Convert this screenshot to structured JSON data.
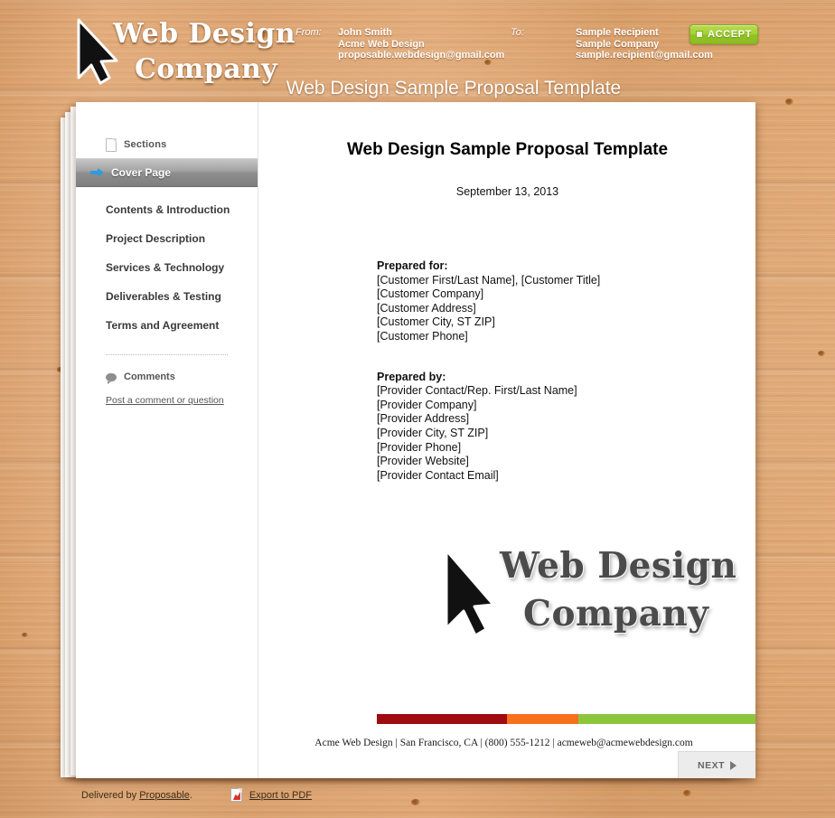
{
  "header": {
    "brand_line1": "Web Design",
    "brand_line2": "Company",
    "brand_cursor_icon": "cursor-arrow-icon",
    "from_label": "From:",
    "from_lines": [
      "John Smith",
      "Acme Web Design",
      "proposable.webdesign@gmail.com"
    ],
    "to_label": "To:",
    "to_lines": [
      "Sample Recipient",
      "Sample Company",
      "sample.recipient@gmail.com"
    ],
    "accept_label": "ACCEPT",
    "accept_icon": "checkbox-square-icon",
    "document_title": "Web Design Sample Proposal Template"
  },
  "sidebar": {
    "sections_label": "Sections",
    "sections_icon": "page-icon",
    "active_icon": "arrow-right-icon",
    "items": [
      {
        "label": "Cover Page",
        "active": true
      },
      {
        "label": "Contents & Introduction",
        "active": false
      },
      {
        "label": "Project Description",
        "active": false
      },
      {
        "label": "Services & Technology",
        "active": false
      },
      {
        "label": "Deliverables & Testing",
        "active": false
      },
      {
        "label": "Terms and Agreement",
        "active": false
      }
    ],
    "comments_label": "Comments",
    "comments_icon": "comment-bubble-icon",
    "comment_link": "Post a comment or question"
  },
  "content": {
    "title": "Web Design Sample Proposal Template",
    "date": "September 13, 2013",
    "prepared_for_heading": "Prepared for:",
    "prepared_for_lines": [
      "[Customer First/Last Name], [Customer Title]",
      "[Customer Company]",
      "[Customer Address]",
      "[Customer City, ST ZIP]",
      "[Customer Phone]"
    ],
    "prepared_by_heading": "Prepared by:",
    "prepared_by_lines": [
      "[Provider Contact/Rep. First/Last Name]",
      "[Provider Company]",
      "[Provider Address]",
      "[Provider City, ST ZIP]",
      "[Provider Phone]",
      "[Provider Website]",
      "[Provider Contact Email]"
    ],
    "logo_line1": "Web Design",
    "logo_line2": "Company",
    "logo_cursor_icon": "cursor-arrow-icon",
    "colorbar": [
      {
        "name": "red",
        "color": "#9e0b10"
      },
      {
        "name": "orange",
        "color": "#f7701d"
      },
      {
        "name": "green",
        "color": "#8cc63f"
      }
    ],
    "footer": "Acme Web Design | San Francisco, CA | (800) 555-1212 | acmeweb@acmewebdesign.com",
    "next_label": "NEXT",
    "next_icon": "triangle-right-icon"
  },
  "bottom_bar": {
    "delivered_prefix": "Delivered by ",
    "delivered_brand": "Proposable",
    "delivered_suffix": ".",
    "export_label": "Export to PDF",
    "export_icon": "pdf-file-icon"
  }
}
